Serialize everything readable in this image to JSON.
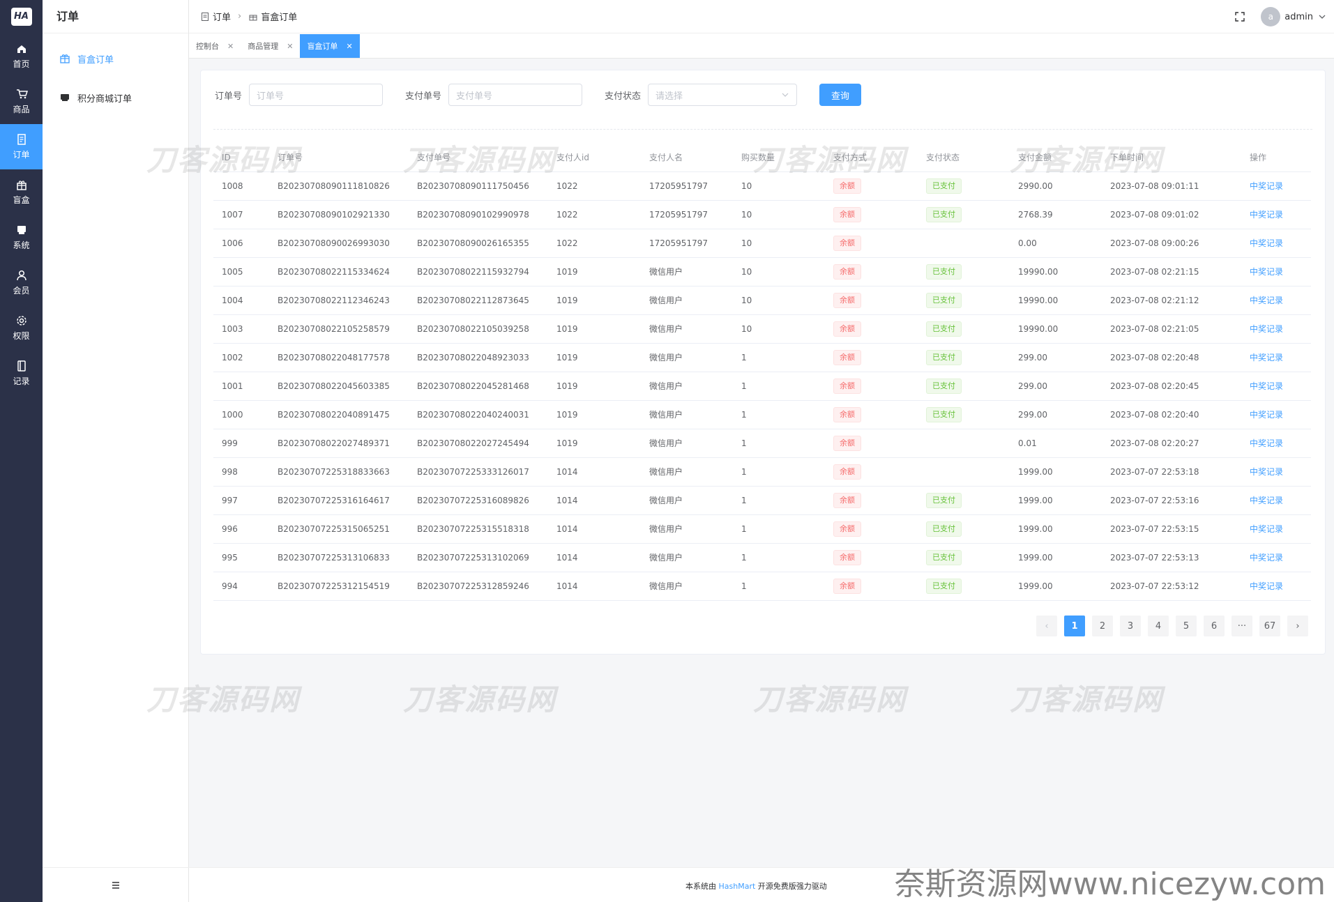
{
  "logo": "HA",
  "rail": [
    {
      "label": "首页",
      "icon": "home-icon"
    },
    {
      "label": "商品",
      "icon": "cart-icon"
    },
    {
      "label": "订单",
      "icon": "order-icon"
    },
    {
      "label": "盲盒",
      "icon": "box-icon"
    },
    {
      "label": "系统",
      "icon": "system-icon"
    },
    {
      "label": "会员",
      "icon": "user-icon"
    },
    {
      "label": "权限",
      "icon": "gear-icon"
    },
    {
      "label": "记录",
      "icon": "record-icon"
    }
  ],
  "subnav": {
    "title": "订单",
    "items": [
      {
        "label": "盲盒订单",
        "icon": "box-icon"
      },
      {
        "label": "积分商城订单",
        "icon": "shop-icon"
      }
    ]
  },
  "breadcrumb": [
    "订单",
    "盲盒订单"
  ],
  "user": {
    "avatar_letter": "a",
    "name": "admin"
  },
  "tabs": [
    {
      "label": "控制台"
    },
    {
      "label": "商品管理"
    },
    {
      "label": "盲盒订单"
    }
  ],
  "filters": {
    "order_no_label": "订单号",
    "order_no_placeholder": "订单号",
    "pay_no_label": "支付单号",
    "pay_no_placeholder": "支付单号",
    "pay_status_label": "支付状态",
    "pay_status_placeholder": "请选择",
    "query_button": "查询"
  },
  "table": {
    "columns": [
      "ID",
      "订单号",
      "支付单号",
      "支付人id",
      "支付人名",
      "购买数量",
      "支付方式",
      "支付状态",
      "支付金额",
      "下单时间",
      "操作"
    ],
    "rows": [
      {
        "id": "1008",
        "order_no": "B20230708090111810826",
        "pay_no": "B20230708090111750456",
        "payer_id": "1022",
        "payer_name": "17205951797",
        "qty": "10",
        "method": "余额",
        "status": "已支付",
        "amount": "2990.00",
        "time": "2023-07-08 09:01:11",
        "action": "中奖记录"
      },
      {
        "id": "1007",
        "order_no": "B20230708090102921330",
        "pay_no": "B20230708090102990978",
        "payer_id": "1022",
        "payer_name": "17205951797",
        "qty": "10",
        "method": "余额",
        "status": "已支付",
        "amount": "2768.39",
        "time": "2023-07-08 09:01:02",
        "action": "中奖记录"
      },
      {
        "id": "1006",
        "order_no": "B20230708090026993030",
        "pay_no": "B20230708090026165355",
        "payer_id": "1022",
        "payer_name": "17205951797",
        "qty": "10",
        "method": "余额",
        "status": "",
        "amount": "0.00",
        "time": "2023-07-08 09:00:26",
        "action": "中奖记录"
      },
      {
        "id": "1005",
        "order_no": "B20230708022115334624",
        "pay_no": "B20230708022115932794",
        "payer_id": "1019",
        "payer_name": "微信用户",
        "qty": "10",
        "method": "余额",
        "status": "已支付",
        "amount": "19990.00",
        "time": "2023-07-08 02:21:15",
        "action": "中奖记录"
      },
      {
        "id": "1004",
        "order_no": "B20230708022112346243",
        "pay_no": "B20230708022112873645",
        "payer_id": "1019",
        "payer_name": "微信用户",
        "qty": "10",
        "method": "余额",
        "status": "已支付",
        "amount": "19990.00",
        "time": "2023-07-08 02:21:12",
        "action": "中奖记录"
      },
      {
        "id": "1003",
        "order_no": "B20230708022105258579",
        "pay_no": "B20230708022105039258",
        "payer_id": "1019",
        "payer_name": "微信用户",
        "qty": "10",
        "method": "余额",
        "status": "已支付",
        "amount": "19990.00",
        "time": "2023-07-08 02:21:05",
        "action": "中奖记录"
      },
      {
        "id": "1002",
        "order_no": "B20230708022048177578",
        "pay_no": "B20230708022048923033",
        "payer_id": "1019",
        "payer_name": "微信用户",
        "qty": "1",
        "method": "余额",
        "status": "已支付",
        "amount": "299.00",
        "time": "2023-07-08 02:20:48",
        "action": "中奖记录"
      },
      {
        "id": "1001",
        "order_no": "B20230708022045603385",
        "pay_no": "B20230708022045281468",
        "payer_id": "1019",
        "payer_name": "微信用户",
        "qty": "1",
        "method": "余额",
        "status": "已支付",
        "amount": "299.00",
        "time": "2023-07-08 02:20:45",
        "action": "中奖记录"
      },
      {
        "id": "1000",
        "order_no": "B20230708022040891475",
        "pay_no": "B20230708022040240031",
        "payer_id": "1019",
        "payer_name": "微信用户",
        "qty": "1",
        "method": "余额",
        "status": "已支付",
        "amount": "299.00",
        "time": "2023-07-08 02:20:40",
        "action": "中奖记录"
      },
      {
        "id": "999",
        "order_no": "B20230708022027489371",
        "pay_no": "B20230708022027245494",
        "payer_id": "1019",
        "payer_name": "微信用户",
        "qty": "1",
        "method": "余额",
        "status": "",
        "amount": "0.01",
        "time": "2023-07-08 02:20:27",
        "action": "中奖记录"
      },
      {
        "id": "998",
        "order_no": "B20230707225318833663",
        "pay_no": "B20230707225333126017",
        "payer_id": "1014",
        "payer_name": "微信用户",
        "qty": "1",
        "method": "余额",
        "status": "",
        "amount": "1999.00",
        "time": "2023-07-07 22:53:18",
        "action": "中奖记录"
      },
      {
        "id": "997",
        "order_no": "B20230707225316164617",
        "pay_no": "B20230707225316089826",
        "payer_id": "1014",
        "payer_name": "微信用户",
        "qty": "1",
        "method": "余额",
        "status": "已支付",
        "amount": "1999.00",
        "time": "2023-07-07 22:53:16",
        "action": "中奖记录"
      },
      {
        "id": "996",
        "order_no": "B20230707225315065251",
        "pay_no": "B20230707225315518318",
        "payer_id": "1014",
        "payer_name": "微信用户",
        "qty": "1",
        "method": "余额",
        "status": "已支付",
        "amount": "1999.00",
        "time": "2023-07-07 22:53:15",
        "action": "中奖记录"
      },
      {
        "id": "995",
        "order_no": "B20230707225313106833",
        "pay_no": "B20230707225313102069",
        "payer_id": "1014",
        "payer_name": "微信用户",
        "qty": "1",
        "method": "余额",
        "status": "已支付",
        "amount": "1999.00",
        "time": "2023-07-07 22:53:13",
        "action": "中奖记录"
      },
      {
        "id": "994",
        "order_no": "B20230707225312154519",
        "pay_no": "B20230707225312859246",
        "payer_id": "1014",
        "payer_name": "微信用户",
        "qty": "1",
        "method": "余额",
        "status": "已支付",
        "amount": "1999.00",
        "time": "2023-07-07 22:53:12",
        "action": "中奖记录"
      }
    ]
  },
  "pagination": {
    "prev": "‹",
    "pages": [
      "1",
      "2",
      "3",
      "4",
      "5",
      "6",
      "···",
      "67"
    ],
    "current": "1",
    "next": "›"
  },
  "footer": {
    "prefix": "本系统由",
    "brand": "HashMart",
    "suffix": "开源免费版强力驱动"
  },
  "watermark": {
    "text": "刀客源码网",
    "site": "奈斯资源网www.nicezyw.com"
  },
  "colors": {
    "primary": "#409eff",
    "rail_bg": "#2b3148",
    "danger": "#f56c6c",
    "success": "#67c23a"
  }
}
